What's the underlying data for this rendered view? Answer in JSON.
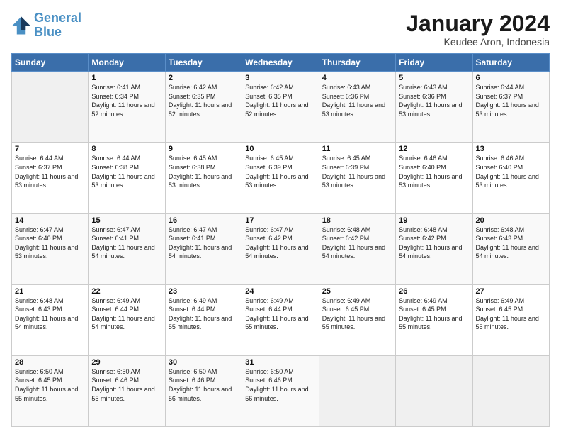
{
  "logo": {
    "line1": "General",
    "line2": "Blue"
  },
  "title": "January 2024",
  "location": "Keudee Aron, Indonesia",
  "days_header": [
    "Sunday",
    "Monday",
    "Tuesday",
    "Wednesday",
    "Thursday",
    "Friday",
    "Saturday"
  ],
  "weeks": [
    [
      {
        "day": "",
        "sunrise": "",
        "sunset": "",
        "daylight": ""
      },
      {
        "day": "1",
        "sunrise": "Sunrise: 6:41 AM",
        "sunset": "Sunset: 6:34 PM",
        "daylight": "Daylight: 11 hours and 52 minutes."
      },
      {
        "day": "2",
        "sunrise": "Sunrise: 6:42 AM",
        "sunset": "Sunset: 6:35 PM",
        "daylight": "Daylight: 11 hours and 52 minutes."
      },
      {
        "day": "3",
        "sunrise": "Sunrise: 6:42 AM",
        "sunset": "Sunset: 6:35 PM",
        "daylight": "Daylight: 11 hours and 52 minutes."
      },
      {
        "day": "4",
        "sunrise": "Sunrise: 6:43 AM",
        "sunset": "Sunset: 6:36 PM",
        "daylight": "Daylight: 11 hours and 53 minutes."
      },
      {
        "day": "5",
        "sunrise": "Sunrise: 6:43 AM",
        "sunset": "Sunset: 6:36 PM",
        "daylight": "Daylight: 11 hours and 53 minutes."
      },
      {
        "day": "6",
        "sunrise": "Sunrise: 6:44 AM",
        "sunset": "Sunset: 6:37 PM",
        "daylight": "Daylight: 11 hours and 53 minutes."
      }
    ],
    [
      {
        "day": "7",
        "sunrise": "Sunrise: 6:44 AM",
        "sunset": "Sunset: 6:37 PM",
        "daylight": "Daylight: 11 hours and 53 minutes."
      },
      {
        "day": "8",
        "sunrise": "Sunrise: 6:44 AM",
        "sunset": "Sunset: 6:38 PM",
        "daylight": "Daylight: 11 hours and 53 minutes."
      },
      {
        "day": "9",
        "sunrise": "Sunrise: 6:45 AM",
        "sunset": "Sunset: 6:38 PM",
        "daylight": "Daylight: 11 hours and 53 minutes."
      },
      {
        "day": "10",
        "sunrise": "Sunrise: 6:45 AM",
        "sunset": "Sunset: 6:39 PM",
        "daylight": "Daylight: 11 hours and 53 minutes."
      },
      {
        "day": "11",
        "sunrise": "Sunrise: 6:45 AM",
        "sunset": "Sunset: 6:39 PM",
        "daylight": "Daylight: 11 hours and 53 minutes."
      },
      {
        "day": "12",
        "sunrise": "Sunrise: 6:46 AM",
        "sunset": "Sunset: 6:40 PM",
        "daylight": "Daylight: 11 hours and 53 minutes."
      },
      {
        "day": "13",
        "sunrise": "Sunrise: 6:46 AM",
        "sunset": "Sunset: 6:40 PM",
        "daylight": "Daylight: 11 hours and 53 minutes."
      }
    ],
    [
      {
        "day": "14",
        "sunrise": "Sunrise: 6:47 AM",
        "sunset": "Sunset: 6:40 PM",
        "daylight": "Daylight: 11 hours and 53 minutes."
      },
      {
        "day": "15",
        "sunrise": "Sunrise: 6:47 AM",
        "sunset": "Sunset: 6:41 PM",
        "daylight": "Daylight: 11 hours and 54 minutes."
      },
      {
        "day": "16",
        "sunrise": "Sunrise: 6:47 AM",
        "sunset": "Sunset: 6:41 PM",
        "daylight": "Daylight: 11 hours and 54 minutes."
      },
      {
        "day": "17",
        "sunrise": "Sunrise: 6:47 AM",
        "sunset": "Sunset: 6:42 PM",
        "daylight": "Daylight: 11 hours and 54 minutes."
      },
      {
        "day": "18",
        "sunrise": "Sunrise: 6:48 AM",
        "sunset": "Sunset: 6:42 PM",
        "daylight": "Daylight: 11 hours and 54 minutes."
      },
      {
        "day": "19",
        "sunrise": "Sunrise: 6:48 AM",
        "sunset": "Sunset: 6:42 PM",
        "daylight": "Daylight: 11 hours and 54 minutes."
      },
      {
        "day": "20",
        "sunrise": "Sunrise: 6:48 AM",
        "sunset": "Sunset: 6:43 PM",
        "daylight": "Daylight: 11 hours and 54 minutes."
      }
    ],
    [
      {
        "day": "21",
        "sunrise": "Sunrise: 6:48 AM",
        "sunset": "Sunset: 6:43 PM",
        "daylight": "Daylight: 11 hours and 54 minutes."
      },
      {
        "day": "22",
        "sunrise": "Sunrise: 6:49 AM",
        "sunset": "Sunset: 6:44 PM",
        "daylight": "Daylight: 11 hours and 54 minutes."
      },
      {
        "day": "23",
        "sunrise": "Sunrise: 6:49 AM",
        "sunset": "Sunset: 6:44 PM",
        "daylight": "Daylight: 11 hours and 55 minutes."
      },
      {
        "day": "24",
        "sunrise": "Sunrise: 6:49 AM",
        "sunset": "Sunset: 6:44 PM",
        "daylight": "Daylight: 11 hours and 55 minutes."
      },
      {
        "day": "25",
        "sunrise": "Sunrise: 6:49 AM",
        "sunset": "Sunset: 6:45 PM",
        "daylight": "Daylight: 11 hours and 55 minutes."
      },
      {
        "day": "26",
        "sunrise": "Sunrise: 6:49 AM",
        "sunset": "Sunset: 6:45 PM",
        "daylight": "Daylight: 11 hours and 55 minutes."
      },
      {
        "day": "27",
        "sunrise": "Sunrise: 6:49 AM",
        "sunset": "Sunset: 6:45 PM",
        "daylight": "Daylight: 11 hours and 55 minutes."
      }
    ],
    [
      {
        "day": "28",
        "sunrise": "Sunrise: 6:50 AM",
        "sunset": "Sunset: 6:45 PM",
        "daylight": "Daylight: 11 hours and 55 minutes."
      },
      {
        "day": "29",
        "sunrise": "Sunrise: 6:50 AM",
        "sunset": "Sunset: 6:46 PM",
        "daylight": "Daylight: 11 hours and 55 minutes."
      },
      {
        "day": "30",
        "sunrise": "Sunrise: 6:50 AM",
        "sunset": "Sunset: 6:46 PM",
        "daylight": "Daylight: 11 hours and 56 minutes."
      },
      {
        "day": "31",
        "sunrise": "Sunrise: 6:50 AM",
        "sunset": "Sunset: 6:46 PM",
        "daylight": "Daylight: 11 hours and 56 minutes."
      },
      {
        "day": "",
        "sunrise": "",
        "sunset": "",
        "daylight": ""
      },
      {
        "day": "",
        "sunrise": "",
        "sunset": "",
        "daylight": ""
      },
      {
        "day": "",
        "sunrise": "",
        "sunset": "",
        "daylight": ""
      }
    ]
  ]
}
